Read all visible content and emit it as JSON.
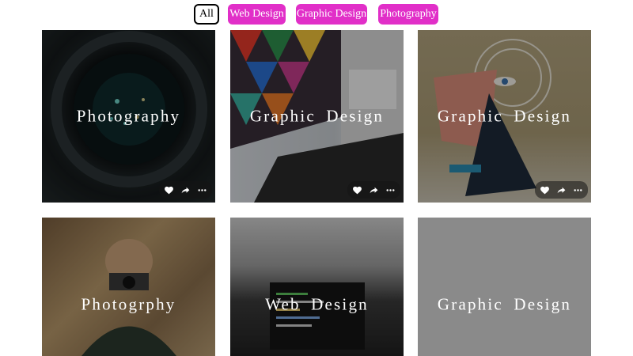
{
  "filters": {
    "all": "All",
    "web_design": "Web Design",
    "graphic_design": "Graphic Design",
    "photography": "Photography"
  },
  "colors": {
    "accent": "#e12fc8"
  },
  "cards": [
    {
      "caption": "Photography",
      "image": "camera-lens",
      "has_actions": true
    },
    {
      "caption": "Graphic  Design",
      "image": "laptop-colorful-art",
      "has_actions": true
    },
    {
      "caption": "Graphic  Design",
      "image": "abstract-poster-eye",
      "has_actions": true
    },
    {
      "caption": "Photogrphy",
      "image": "boy-with-camera",
      "has_actions": false
    },
    {
      "caption": "Web  Design",
      "image": "code-on-laptop",
      "has_actions": false
    },
    {
      "caption": "Graphic  Design",
      "image": "gray-placeholder",
      "has_actions": false
    }
  ],
  "icons": {
    "like": "heart-icon",
    "share": "share-icon",
    "more": "more-icon"
  }
}
